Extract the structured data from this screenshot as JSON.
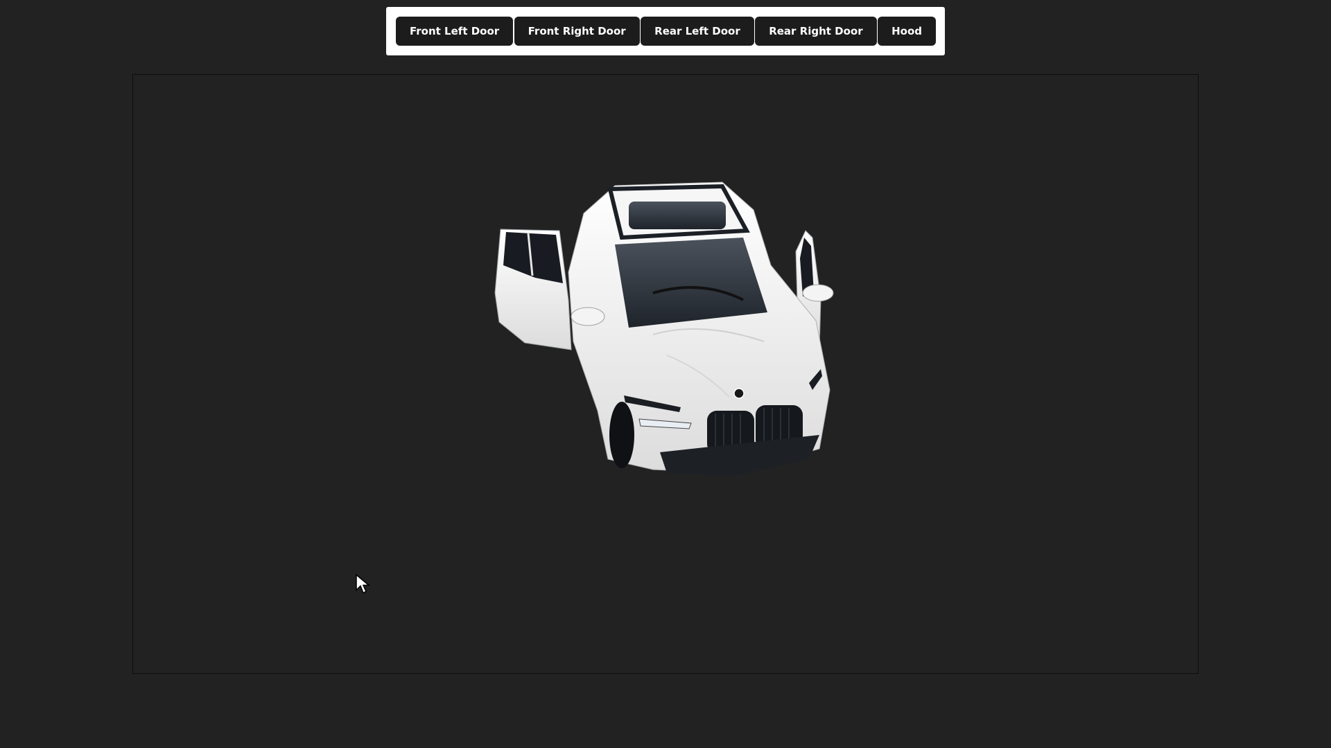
{
  "toolbar": {
    "buttons": [
      {
        "label": "Front Left Door"
      },
      {
        "label": "Front Right Door"
      },
      {
        "label": "Rear Left Door"
      },
      {
        "label": "Rear Right Door"
      },
      {
        "label": "Hood"
      }
    ]
  },
  "viewer": {
    "model": "white-suv-3d-model",
    "colors": {
      "background": "#222222",
      "car_body": "#f2f2f2",
      "glass": "#2a3038"
    }
  },
  "cursor": {
    "icon": "arrow-pointer-icon"
  }
}
